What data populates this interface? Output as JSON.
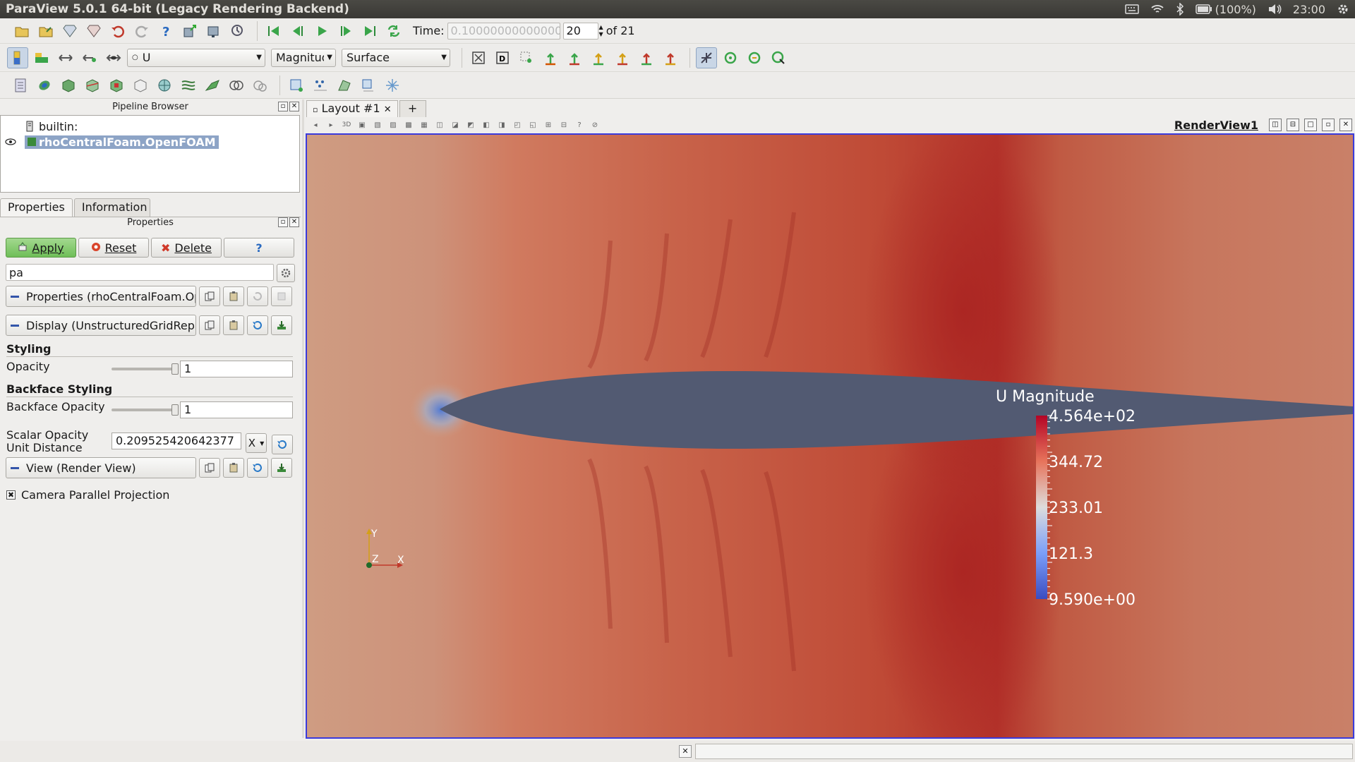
{
  "window": {
    "title": "ParaView 5.0.1 64-bit (Legacy Rendering Backend)"
  },
  "tray": {
    "battery": "(100%)",
    "clock": "23:00"
  },
  "toolbar_time": {
    "label": "Time:",
    "value": "0.100000000000000",
    "index": "20",
    "of_label": "of 21"
  },
  "toolbar_display": {
    "array": "U",
    "component": "Magnitud",
    "representation": "Surface"
  },
  "pipeline_browser": {
    "title": "Pipeline Browser",
    "items": [
      {
        "label": "builtin:"
      },
      {
        "label": "rhoCentralFoam.OpenFOAM"
      }
    ]
  },
  "tabs": {
    "properties": "Properties",
    "information": "Information"
  },
  "properties_panel": {
    "title": "Properties",
    "apply": "Apply",
    "reset": "Reset",
    "delete": "Delete",
    "help": "?",
    "search_value": "pa",
    "section_properties": "Properties (rhoCentralFoam.OpenFOAM)",
    "section_display": "Display (UnstructuredGridRepresentation)",
    "styling_heading": "Styling",
    "opacity_label": "Opacity",
    "opacity_value": "1",
    "backface_heading": "Backface Styling",
    "backface_opacity_label": "Backface Opacity",
    "backface_opacity_value": "1",
    "scalar_opacity_label_1": "Scalar Opacity",
    "scalar_opacity_label_2": "Unit Distance",
    "scalar_opacity_value": "0.209525420642377",
    "scalar_axis": "X",
    "section_view": "View (Render View)",
    "camera_parallel_label": "Camera Parallel Projection",
    "opacity_level": 1.0,
    "backface_opacity_level": 1.0
  },
  "layout": {
    "tab_label": "Layout #1",
    "add_tab": "+",
    "view_name": "RenderView1"
  },
  "render_view": {
    "scalar_bar": {
      "title": "U Magnitude",
      "labels": [
        "4.564e+02",
        "344.72",
        "233.01",
        "121.3",
        "9.590e+00"
      ]
    },
    "axes": {
      "x": "X",
      "y": "Y",
      "z": "Z"
    },
    "colors": {
      "airfoil": "#525a72",
      "flow": "#c8634a",
      "shock": "#b02b25",
      "freestream": "#cd9279"
    }
  }
}
